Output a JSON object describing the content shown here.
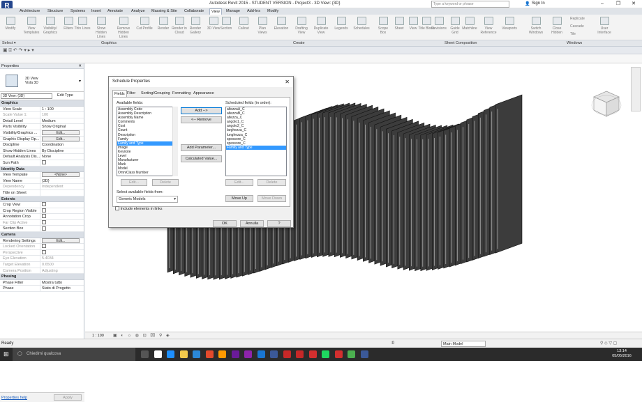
{
  "window": {
    "title": "Autodesk Revit 2015 -  STUDENT VERSION -    Project3 - 3D View: {3D}",
    "search_placeholder": "Type a keyword or phrase",
    "sign_in": "Sign In",
    "app_letter": "R"
  },
  "ribbon_tabs": [
    "Architecture",
    "Structure",
    "Systems",
    "Insert",
    "Annotate",
    "Analyze",
    "Massing & Site",
    "Collaborate",
    "View",
    "Manage",
    "Add-Ins",
    "Modify"
  ],
  "active_tab": "View",
  "ribbon_buttons": [
    "Modify",
    "View Templates",
    "Visibility/ Graphics",
    "Filters",
    "Thin Lines",
    "Show Hidden Lines",
    "Remove Hidden Lines",
    "Cut Profile",
    "Render",
    "Render in Cloud",
    "Render Gallery",
    "3D View",
    "Section",
    "Callout",
    "Plan Views",
    "Elevation",
    "Drafting View",
    "Duplicate View",
    "Legends",
    "Schedules",
    "Scope Box",
    "Sheet",
    "View",
    "Title Block",
    "Revisions",
    "Guide Grid",
    "Matchline",
    "View Reference",
    "Viewports",
    "Switch Windows",
    "Close Hidden",
    "Replicate",
    "Cascade",
    "Tile",
    "User Interface"
  ],
  "ribbon_panels": [
    "Select ▾",
    "Graphics",
    "Create",
    "Sheet Composition",
    "Windows"
  ],
  "properties": {
    "header": "Properties",
    "type_name_1": "3D View",
    "type_name_2": "Vista 3D",
    "selector": "3D View: {3D}",
    "edit_type": "Edit Type",
    "rows": [
      {
        "g": "Graphics"
      },
      {
        "k": "View Scale",
        "v": "1 : 100"
      },
      {
        "k": "Scale Value    1:",
        "v": "100",
        "dim": true
      },
      {
        "k": "Detail Level",
        "v": "Medium"
      },
      {
        "k": "Parts Visibility",
        "v": "Show Original"
      },
      {
        "k": "Visibility/Graphics ...",
        "b": "Edit..."
      },
      {
        "k": "Graphic Display Op...",
        "b": "Edit..."
      },
      {
        "k": "Discipline",
        "v": "Coordination"
      },
      {
        "k": "Show Hidden Lines",
        "v": "By Discipline"
      },
      {
        "k": "Default Analysis Dis...",
        "v": "None"
      },
      {
        "k": "Sun Path",
        "c": true
      },
      {
        "g": "Identity Data"
      },
      {
        "k": "View Template",
        "b": "<None>"
      },
      {
        "k": "View Name",
        "v": "{3D}"
      },
      {
        "k": "Dependency",
        "v": "Independent",
        "dim": true
      },
      {
        "k": "Title on Sheet",
        "v": ""
      },
      {
        "g": "Extents"
      },
      {
        "k": "Crop View",
        "c": true
      },
      {
        "k": "Crop Region Visible",
        "c": true
      },
      {
        "k": "Annotation Crop",
        "c": true
      },
      {
        "k": "Far Clip Active",
        "c": true,
        "dim": true
      },
      {
        "k": "Section Box",
        "c": true
      },
      {
        "g": "Camera"
      },
      {
        "k": "Rendering Settings",
        "b": "Edit..."
      },
      {
        "k": "Locked Orientation",
        "c": true,
        "dim": true
      },
      {
        "k": "Perspective",
        "c": true,
        "dim": true
      },
      {
        "k": "Eye Elevation",
        "v": "5.4034",
        "dim": true
      },
      {
        "k": "Target Elevation",
        "v": "0.6500",
        "dim": true
      },
      {
        "k": "Camera Position",
        "v": "Adjusting",
        "dim": true
      },
      {
        "g": "Phasing"
      },
      {
        "k": "Phase Filter",
        "v": "Mostra tutto"
      },
      {
        "k": "Phase",
        "v": "Stato di Progetto"
      }
    ],
    "help": "Properties help",
    "apply": "Apply"
  },
  "dialog": {
    "title": "Schedule Properties",
    "tabs": [
      "Fields",
      "Filter",
      "Sorting/Grouping",
      "Formatting",
      "Appearance"
    ],
    "available_label": "Available fields:",
    "available": [
      "Assembly Code",
      "Assembly Description",
      "Assembly Name",
      "Comments",
      "Cost",
      "Count",
      "Description",
      "Family",
      "Family and Type",
      "Image",
      "Keynote",
      "Level",
      "Manufacturer",
      "Mark",
      "Model",
      "OmniClass Number"
    ],
    "available_selected": "Family and Type",
    "scheduled_label": "Scheduled fields (in order):",
    "scheduled": [
      "altezzaA_C",
      "altezzaB_C",
      "altezza_C",
      "angolo1_C",
      "angolo2_C",
      "larghezza_C",
      "lunghezza_C",
      "spessore_C",
      "spessore_C",
      "Family and Type"
    ],
    "scheduled_selected": "Family and Type",
    "add": "Add -->",
    "remove": "<-- Remove",
    "add_param": "Add Parameter...",
    "calc": "Calculated Value...",
    "edit": "Edit...",
    "delete": "Delete",
    "move_up": "Move Up",
    "move_down": "Move Down",
    "select_from_label": "Select available fields from:",
    "select_from": "Generic Models",
    "include_links": "Include elements in links",
    "ok": "OK",
    "cancel": "Annulla",
    "help": "?"
  },
  "view_bar": {
    "scale": "1 : 100"
  },
  "status": {
    "text": "Ready",
    "model": "Main Model",
    "zero": ":0"
  },
  "taskbar": {
    "search": "Chiedimi qualcosa",
    "time": "13:14",
    "date": "05/05/2016"
  },
  "colors": {
    "ribbon_accent": "#24468d",
    "selection": "#3399ff",
    "taskbar": "#2b2b2b"
  }
}
